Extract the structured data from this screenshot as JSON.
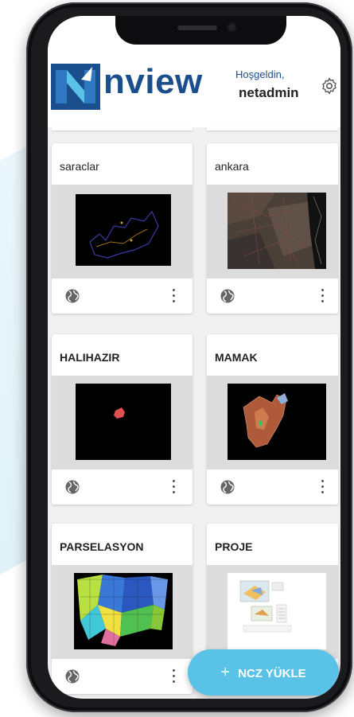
{
  "header": {
    "logo_text": "nview",
    "welcome": "Hoşgeldin,",
    "username": "netadmin"
  },
  "cards": [
    {
      "title": "saraclar"
    },
    {
      "title": "ankara"
    },
    {
      "title": "HALIHAZIR"
    },
    {
      "title": "MAMAK"
    },
    {
      "title": "PARSELASYON"
    },
    {
      "title": "PROJE"
    }
  ],
  "fab": {
    "label": "NCZ YÜKLE"
  },
  "colors": {
    "brand": "#1b4e8c",
    "accent": "#5bc2e7"
  },
  "icons": [
    "gear-icon",
    "globe-icon",
    "more-vertical-icon",
    "plus-icon"
  ]
}
